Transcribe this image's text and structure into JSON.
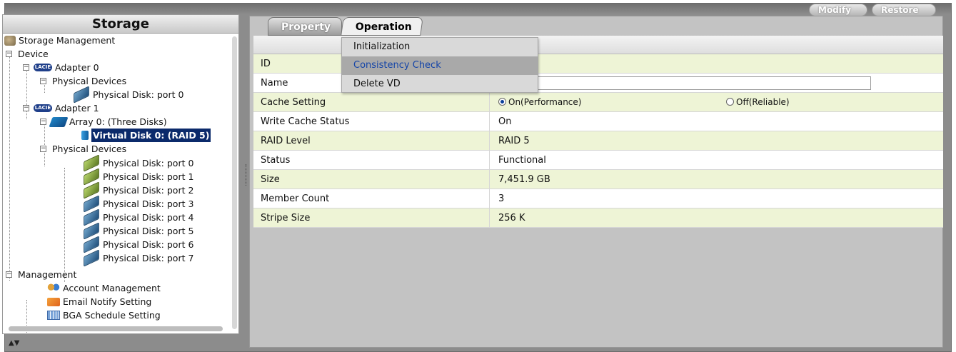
{
  "left_panel": {
    "title": "Storage",
    "tree": {
      "storage_management": "Storage Management",
      "device": "Device",
      "adapter0": {
        "label": "Adapter 0",
        "icon": "LACIE",
        "physical_devices": "Physical Devices",
        "disks": [
          "Physical Disk: port 0"
        ]
      },
      "adapter1": {
        "label": "Adapter 1",
        "icon": "LACIE",
        "array": "Array 0: (Three Disks)",
        "virtual_disk": "Virtual Disk 0: (RAID 5)",
        "physical_devices": "Physical Devices",
        "disks": [
          "Physical Disk: port 0",
          "Physical Disk: port 1",
          "Physical Disk: port 2",
          "Physical Disk: port 3",
          "Physical Disk: port 4",
          "Physical Disk: port 5",
          "Physical Disk: port 6",
          "Physical Disk: port 7"
        ]
      },
      "management": "Management",
      "account_management": "Account Management",
      "email_notify": "Email Notify Setting",
      "bga_schedule": "BGA Schedule Setting"
    }
  },
  "tabs": {
    "property": "Property",
    "operation": "Operation"
  },
  "operation_menu": [
    "Initialization",
    "Consistency Check",
    "Delete VD"
  ],
  "toolbar": {
    "modify": "Modify",
    "restore": "Restore"
  },
  "properties": {
    "id_label": "ID",
    "name_label": "Name",
    "cache_label": "Cache Setting",
    "cache_on": "On(Performance)",
    "cache_off": "Off(Reliable)",
    "write_cache_label": "Write Cache Status",
    "write_cache_value": "On",
    "raid_label": "RAID Level",
    "raid_value": "RAID 5",
    "status_label": "Status",
    "status_value": "Functional",
    "size_label": "Size",
    "size_value": "7,451.9 GB",
    "member_label": "Member Count",
    "member_value": "3",
    "stripe_label": "Stripe Size",
    "stripe_value": "256 K"
  }
}
